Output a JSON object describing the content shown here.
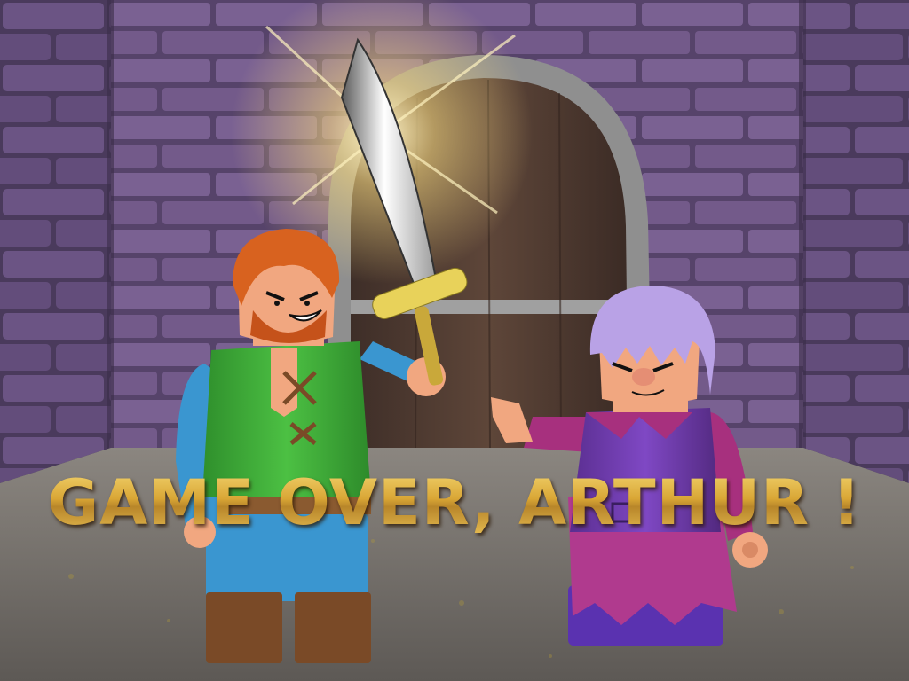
{
  "screen": {
    "message": "GAME OVER, ARTHUR !"
  },
  "characters": [
    {
      "role": "hero",
      "hair_color": "#d8621f",
      "shirt_color": "#3fae3a",
      "icon": "bearded-hero"
    },
    {
      "role": "villain",
      "hair_color": "#b9a2e6",
      "dress_color": "#6c3aa6",
      "icon": "old-witch"
    }
  ],
  "props": {
    "sword_icon": "scimitar-icon",
    "door_icon": "wooden-door-icon"
  },
  "colors": {
    "wall": "#6e5683",
    "floor": "#77726c",
    "text_gold": "#e1b544"
  }
}
